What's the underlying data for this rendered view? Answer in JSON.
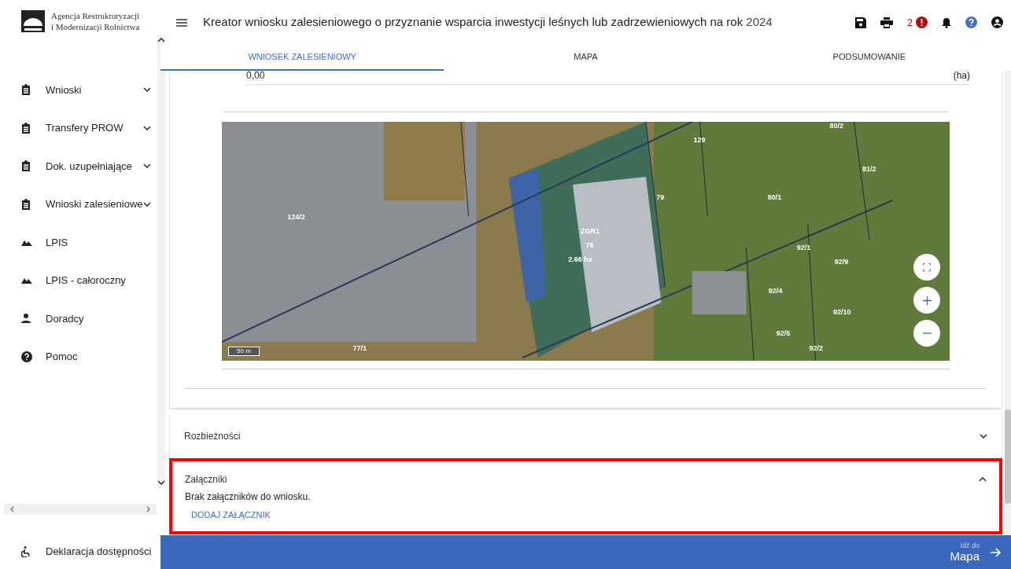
{
  "logo": {
    "line_1": "Agencja Restrukturyzacji",
    "line_2": "i Modernizacji Rolnictwa"
  },
  "sidebar": {
    "items": [
      {
        "label": "Wnioski",
        "kind": "clipboard",
        "expandable": true
      },
      {
        "label": "Transfery PROW",
        "kind": "clipboard",
        "expandable": true
      },
      {
        "label": "Dok. uzupełniające",
        "kind": "clipboard",
        "expandable": true
      },
      {
        "label": "Wnioski zalesieniowe",
        "kind": "clipboard",
        "expandable": true
      },
      {
        "label": "LPIS",
        "kind": "terrain",
        "expandable": false
      },
      {
        "label": "LPIS - całoroczny",
        "kind": "terrain",
        "expandable": false
      },
      {
        "label": "Doradcy",
        "kind": "person",
        "expandable": false
      },
      {
        "label": "Pomoc",
        "kind": "help",
        "expandable": false
      }
    ],
    "footer": "Deklaracja dostępności"
  },
  "header": {
    "title": "Kreator wniosku zalesieniowego o przyznanie wsparcia inwestycji leśnych lub zadrzewieniowych na rok",
    "year": "2024",
    "error_count": "2"
  },
  "tabs": [
    {
      "label": "WNIOSEK ZALESIENIOWY",
      "selected": true
    },
    {
      "label": "MAPA",
      "selected": false
    },
    {
      "label": "PODSUMOWANIE",
      "selected": false
    }
  ],
  "area_field": {
    "value": "0,00",
    "unit": "(ha)"
  },
  "map": {
    "scale": "50 m",
    "parcels": [
      "80/2",
      "129",
      "81/2",
      "79",
      "80/1",
      "124/2",
      "ZGR1",
      "78",
      "92/1",
      "2.66 ha",
      "92/9",
      "92/4",
      "92/10",
      "92/5",
      "77/1",
      "92/2"
    ]
  },
  "sections": [
    {
      "title": "Rozbieżności",
      "expanded": false
    },
    {
      "title": "Załączniki",
      "expanded": true,
      "message": "Brak załączników do wniosku.",
      "action": "DODAJ ZAŁĄCZNIK"
    }
  ],
  "footer_bar": {
    "caption": "Idź do",
    "target": "Mapa"
  }
}
